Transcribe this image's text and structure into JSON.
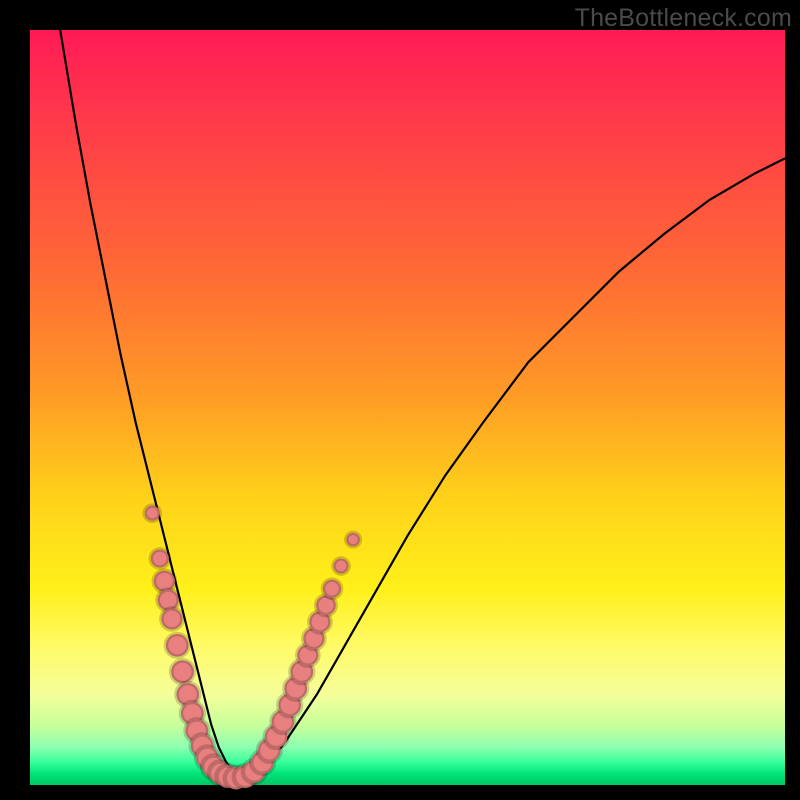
{
  "watermark": "TheBottleneck.com",
  "colors": {
    "frame": "#000000",
    "bead": "#e98080",
    "curve": "#000000",
    "gradient_top": "#ff1a56",
    "gradient_bottom": "#00c862"
  },
  "chart_data": {
    "type": "line",
    "title": "",
    "xlabel": "",
    "ylabel": "",
    "xlim": [
      0,
      100
    ],
    "ylim": [
      0,
      100
    ],
    "grid": false,
    "legend": false,
    "note": "x and y are percentage of plot width/height; y=0 at bottom, y=100 at top",
    "series": [
      {
        "name": "bottleneck-curve",
        "x": [
          4,
          6,
          8,
          10,
          12,
          14,
          16,
          18,
          19,
          20,
          21,
          22,
          23,
          24,
          25,
          26,
          27,
          29,
          31,
          34,
          38,
          42,
          46,
          50,
          55,
          60,
          66,
          72,
          78,
          84,
          90,
          96,
          100
        ],
        "y": [
          100,
          88,
          77,
          67,
          57,
          48,
          40,
          32,
          28,
          24,
          20,
          16,
          12,
          8,
          5,
          3,
          1.5,
          1,
          2,
          6,
          12,
          19,
          26,
          33,
          41,
          48,
          56,
          62,
          68,
          73,
          77.5,
          81,
          83
        ]
      }
    ],
    "beads": {
      "name": "highlight-beads",
      "points": [
        {
          "x": 16.2,
          "y": 36,
          "r": 1.0
        },
        {
          "x": 17.2,
          "y": 30,
          "r": 1.2
        },
        {
          "x": 17.8,
          "y": 27,
          "r": 1.4
        },
        {
          "x": 18.3,
          "y": 24.5,
          "r": 1.4
        },
        {
          "x": 18.8,
          "y": 22,
          "r": 1.4
        },
        {
          "x": 19.5,
          "y": 18.5,
          "r": 1.5
        },
        {
          "x": 20.2,
          "y": 15,
          "r": 1.5
        },
        {
          "x": 20.9,
          "y": 12,
          "r": 1.5
        },
        {
          "x": 21.5,
          "y": 9.5,
          "r": 1.5
        },
        {
          "x": 22.1,
          "y": 7.2,
          "r": 1.5
        },
        {
          "x": 22.8,
          "y": 5.2,
          "r": 1.5
        },
        {
          "x": 23.5,
          "y": 3.6,
          "r": 1.5
        },
        {
          "x": 24.3,
          "y": 2.4,
          "r": 1.5
        },
        {
          "x": 25.2,
          "y": 1.6,
          "r": 1.5
        },
        {
          "x": 26.2,
          "y": 1.1,
          "r": 1.5
        },
        {
          "x": 27.3,
          "y": 0.9,
          "r": 1.5
        },
        {
          "x": 28.5,
          "y": 1.1,
          "r": 1.5
        },
        {
          "x": 29.7,
          "y": 1.8,
          "r": 1.5
        },
        {
          "x": 30.8,
          "y": 3.0,
          "r": 1.5
        },
        {
          "x": 31.7,
          "y": 4.6,
          "r": 1.5
        },
        {
          "x": 32.6,
          "y": 6.4,
          "r": 1.5
        },
        {
          "x": 33.5,
          "y": 8.4,
          "r": 1.5
        },
        {
          "x": 34.4,
          "y": 10.6,
          "r": 1.5
        },
        {
          "x": 35.2,
          "y": 12.8,
          "r": 1.5
        },
        {
          "x": 36.0,
          "y": 15.0,
          "r": 1.5
        },
        {
          "x": 36.8,
          "y": 17.2,
          "r": 1.4
        },
        {
          "x": 37.6,
          "y": 19.4,
          "r": 1.4
        },
        {
          "x": 38.4,
          "y": 21.6,
          "r": 1.4
        },
        {
          "x": 39.2,
          "y": 23.8,
          "r": 1.3
        },
        {
          "x": 40.0,
          "y": 26.0,
          "r": 1.2
        },
        {
          "x": 41.2,
          "y": 29.0,
          "r": 1.0
        },
        {
          "x": 42.8,
          "y": 32.5,
          "r": 0.9
        }
      ]
    }
  }
}
